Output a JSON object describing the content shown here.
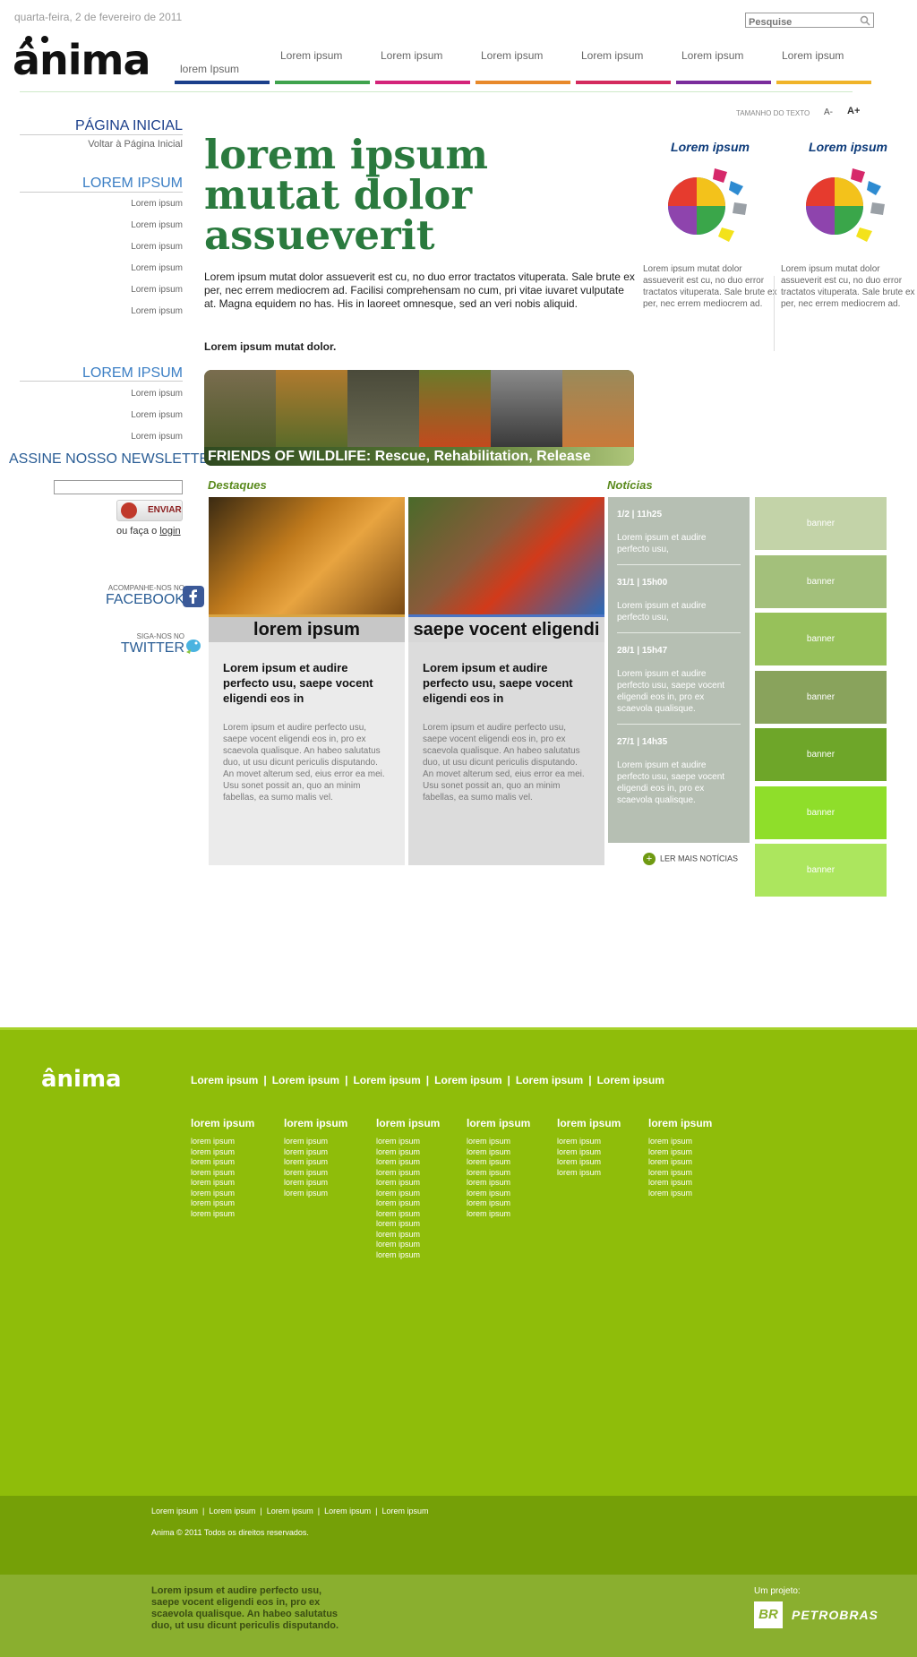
{
  "header": {
    "date": "quarta-feira, 2 de fevereiro de 2011",
    "search_placeholder": "Pesquise",
    "logo": "ânima"
  },
  "nav": [
    {
      "label": "lorem Ipsum",
      "color": "#1b3f8b"
    },
    {
      "label": "Lorem ipsum",
      "color": "#3fa34d"
    },
    {
      "label": "Lorem ipsum",
      "color": "#d4237a"
    },
    {
      "label": "Lorem ipsum",
      "color": "#e8892b"
    },
    {
      "label": "Lorem ipsum",
      "color": "#d42a5e"
    },
    {
      "label": "Lorem ipsum",
      "color": "#7a2c9c"
    },
    {
      "label": "Lorem ipsum",
      "color": "#f0b429"
    }
  ],
  "sidebar": {
    "home_title": "PÁGINA INICIAL",
    "home_link": "Voltar à Página Inicial",
    "section1_title": "LOREM IPSUM",
    "section1_links": [
      "Lorem ipsum",
      "Lorem ipsum",
      "Lorem ipsum",
      "Lorem ipsum",
      "Lorem ipsum",
      "Lorem ipsum"
    ],
    "section2_title": "LOREM IPSUM",
    "section2_links": [
      "Lorem ipsum",
      "Lorem ipsum",
      "Lorem ipsum"
    ],
    "newsletter_title": "ASSINE NOSSO NEWSLETTER",
    "send_label": "ENVIAR",
    "login_prefix": "ou faça o",
    "login_label": "login",
    "facebook_small": "ACOMPANHE-NOS NO",
    "facebook_big": "FACEBOOK",
    "twitter_small": "SIGA-NOS NO",
    "twitter_big": "TWITTER"
  },
  "text_size": {
    "label": "TAMANHO DO TEXTO",
    "minus": "A-",
    "plus": "A+"
  },
  "main": {
    "headline": "lorem ipsum mutat dolor assueverit",
    "intro": "Lorem ipsum mutat dolor assueverit est cu, no duo error tractatos vituperata. Sale brute ex per, nec errem mediocrem ad. Facilisi comprehensam no cum, pri vitae iuvaret vulputate at. Magna equidem no has. His in laoreet omnesque, sed an veri nobis aliquid.",
    "intro_bold": "Lorem ipsum mutat dolor.",
    "wildlife_caption": "FRIENDS OF WILDLIFE: Rescue, Rehabilitation, Release"
  },
  "puzzles": [
    {
      "title": "Lorem ipsum",
      "text": "Lorem ipsum mutat dolor assueverit est cu, no duo error tractatos vituperata. Sale brute ex per, nec errem mediocrem ad."
    },
    {
      "title": "Lorem ipsum",
      "text": "Lorem ipsum mutat dolor assueverit est cu, no duo error tractatos vituperata. Sale brute ex per, nec errem mediocrem ad."
    }
  ],
  "destaques": {
    "title": "Destaques",
    "cards": [
      {
        "band": "lorem ipsum",
        "heading": "Lorem ipsum et audire perfecto usu, saepe vocent eligendi eos in",
        "body": "Lorem ipsum et audire perfecto usu, saepe vocent eligendi eos in, pro ex scaevola qualisque. An habeo salutatus duo, ut usu dicunt periculis disputando. An movet alterum sed, eius error ea mei. Usu sonet possit an, quo an minim fabellas, ea sumo malis vel."
      },
      {
        "band": "saepe vocent eligendi",
        "heading": "Lorem ipsum et audire perfecto usu, saepe vocent eligendi eos in",
        "body": "Lorem ipsum et audire perfecto usu, saepe vocent eligendi eos in, pro ex scaevola qualisque. An habeo salutatus duo, ut usu dicunt periculis disputando. An movet alterum sed, eius error ea mei. Usu sonet possit an, quo an minim fabellas, ea sumo malis vel."
      }
    ]
  },
  "noticias": {
    "title": "Notícias",
    "items": [
      {
        "date": "1/2 | 11h25",
        "text": "Lorem ipsum et audire perfecto usu,"
      },
      {
        "date": "31/1 | 15h00",
        "text": "Lorem ipsum et audire perfecto usu,"
      },
      {
        "date": "28/1 | 15h47",
        "text": "Lorem ipsum et audire perfecto usu, saepe vocent eligendi eos in, pro ex scaevola qualisque."
      },
      {
        "date": "27/1 | 14h35",
        "text": "Lorem ipsum et audire perfecto usu, saepe vocent eligendi eos in, pro ex scaevola qualisque."
      }
    ],
    "more": "LER MAIS NOTÍCIAS"
  },
  "banners": [
    {
      "label": "banner",
      "color": "#c3d3a8"
    },
    {
      "label": "banner",
      "color": "#a3c07b"
    },
    {
      "label": "banner",
      "color": "#97c15a"
    },
    {
      "label": "banner",
      "color": "#89a35c"
    },
    {
      "label": "banner",
      "color": "#6ea629"
    },
    {
      "label": "banner",
      "color": "#8fde2a"
    },
    {
      "label": "banner",
      "color": "#ace65e"
    }
  ],
  "footer": {
    "logo": "ânima",
    "top_links": [
      "Lorem ipsum",
      "Lorem ipsum",
      "Lorem ipsum",
      "Lorem ipsum",
      "Lorem ipsum",
      "Lorem ipsum"
    ],
    "columns": [
      {
        "title": "lorem ipsum",
        "links": [
          "lorem ipsum",
          "lorem ipsum",
          "lorem ipsum",
          "lorem ipsum",
          "lorem ipsum",
          "lorem ipsum",
          "lorem ipsum",
          "lorem ipsum"
        ]
      },
      {
        "title": "lorem ipsum",
        "links": [
          "lorem ipsum",
          "lorem ipsum",
          "lorem ipsum",
          "lorem ipsum",
          "lorem ipsum",
          "lorem ipsum"
        ]
      },
      {
        "title": "lorem ipsum",
        "links": [
          "lorem ipsum",
          "lorem ipsum",
          "lorem ipsum",
          "lorem ipsum",
          "lorem ipsum",
          "lorem ipsum",
          "lorem ipsum",
          "lorem ipsum",
          "lorem ipsum",
          "lorem ipsum",
          "lorem ipsum",
          "lorem ipsum"
        ]
      },
      {
        "title": "lorem ipsum",
        "links": [
          "lorem ipsum",
          "lorem ipsum",
          "lorem ipsum",
          "lorem ipsum",
          "lorem ipsum",
          "lorem ipsum",
          "lorem ipsum",
          "lorem ipsum"
        ]
      },
      {
        "title": "lorem ipsum",
        "links": [
          "lorem ipsum",
          "lorem ipsum",
          "lorem ipsum",
          "lorem ipsum"
        ]
      },
      {
        "title": "lorem ipsum",
        "links": [
          "lorem ipsum",
          "lorem ipsum",
          "lorem ipsum",
          "lorem ipsum",
          "lorem ipsum",
          "lorem ipsum"
        ]
      }
    ],
    "bottom_links": [
      "Lorem ipsum",
      "Lorem ipsum",
      "Lorem ipsum",
      "Lorem ipsum",
      "Lorem ipsum"
    ],
    "copyright": "Anima © 2011 Todos os direitos reservados.",
    "bottom_text": "Lorem ipsum et audire perfecto usu, saepe vocent eligendi eos in, pro ex scaevola qualisque. An habeo salutatus duo, ut usu dicunt periculis disputando.",
    "project_label": "Um projeto:",
    "sponsor_mark": "BR",
    "sponsor": "PETROBRAS"
  }
}
